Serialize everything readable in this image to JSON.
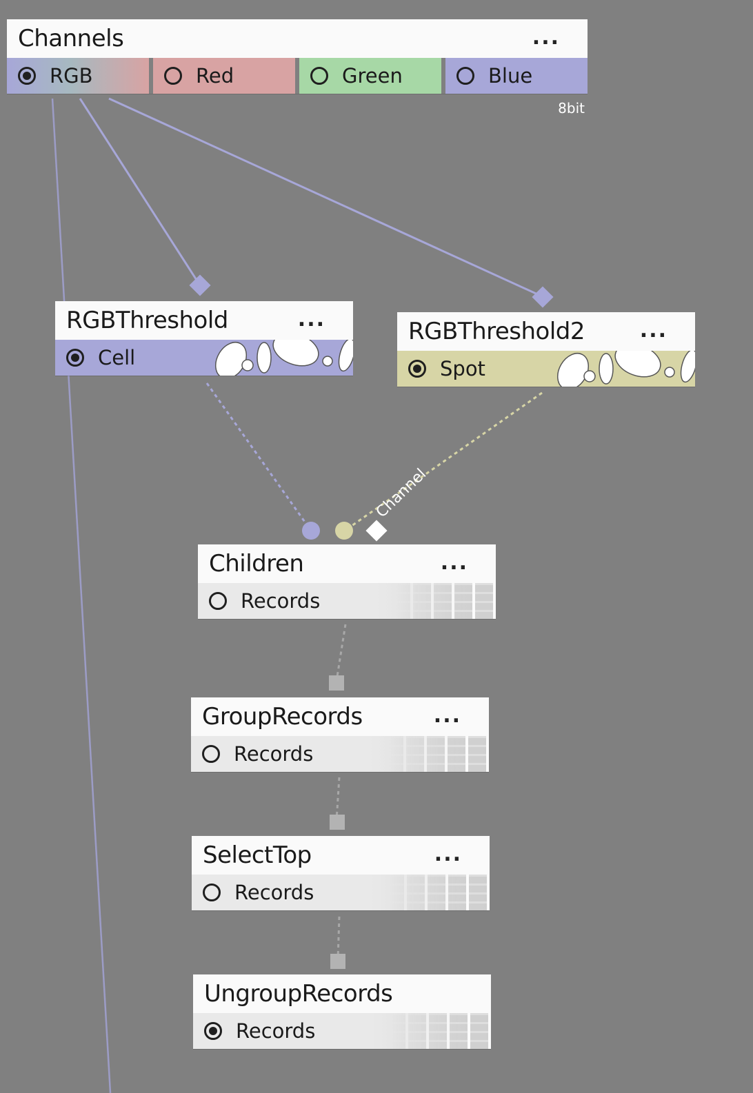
{
  "colors": {
    "background": "#808080",
    "rgb_link": "#a7a7d8",
    "spot_link": "#d7d5a6",
    "records_link": "#a8a8a8",
    "red_port": "#d8a3a3",
    "green_port": "#a7d8a6",
    "blue_port": "#a7a7d8",
    "spot_port": "#d7d5a6",
    "records_port": "#e9e9e9"
  },
  "nodes": {
    "channels": {
      "title": "Channels",
      "menu": "...",
      "badge": "8bit",
      "ports": [
        {
          "label": "RGB",
          "selected": true
        },
        {
          "label": "Red",
          "selected": false
        },
        {
          "label": "Green",
          "selected": false
        },
        {
          "label": "Blue",
          "selected": false
        }
      ]
    },
    "rgb_threshold": {
      "title": "RGBThreshold",
      "menu": "...",
      "ports": [
        {
          "label": "Cell",
          "selected": true
        }
      ]
    },
    "rgb_threshold2": {
      "title": "RGBThreshold2",
      "menu": "...",
      "ports": [
        {
          "label": "Spot",
          "selected": true
        }
      ]
    },
    "children": {
      "title": "Children",
      "menu": "...",
      "input_label": "Channel",
      "ports": [
        {
          "label": "Records",
          "selected": false
        }
      ]
    },
    "group_records": {
      "title": "GroupRecords",
      "menu": "...",
      "ports": [
        {
          "label": "Records",
          "selected": false
        }
      ]
    },
    "select_top": {
      "title": "SelectTop",
      "menu": "...",
      "ports": [
        {
          "label": "Records",
          "selected": false
        }
      ]
    },
    "ungroup_records": {
      "title": "UngroupRecords",
      "ports": [
        {
          "label": "Records",
          "selected": true
        }
      ]
    }
  }
}
